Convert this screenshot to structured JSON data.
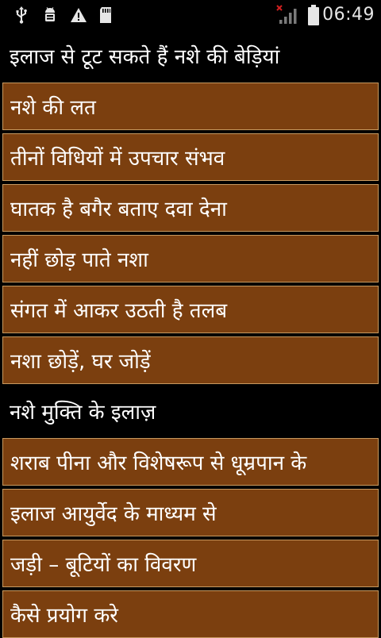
{
  "status_bar": {
    "icons": [
      "usb-icon",
      "android-debug-icon",
      "warning-icon",
      "sd-card-icon",
      "signal-no-service-icon",
      "battery-icon"
    ],
    "time": "06:49"
  },
  "list": {
    "rows": [
      {
        "type": "header",
        "label": "इलाज से टूट सकते हैं नशे की बेड़ियां"
      },
      {
        "type": "item",
        "label": "नशे की लत"
      },
      {
        "type": "item",
        "label": "तीनों विधियों में उपचार संभव"
      },
      {
        "type": "item",
        "label": "घातक है बगैर बताए दवा देना"
      },
      {
        "type": "item",
        "label": "नहीं छोड़ पाते नशा"
      },
      {
        "type": "item",
        "label": "संगत में आकर उठती है तलब"
      },
      {
        "type": "item",
        "label": "नशा छोड़ें, घर जोड़ें"
      },
      {
        "type": "header",
        "label": "नशे मुक्ति के इलाज़"
      },
      {
        "type": "item",
        "label": "शराब पीना और विशेषरूप से धूम्रपान के"
      },
      {
        "type": "item",
        "label": "इलाज आयुर्वेद के माध्यम से"
      },
      {
        "type": "item",
        "label": "जड़ी – बूटियों का विवरण"
      },
      {
        "type": "item",
        "label": "कैसे प्रयोग करे"
      }
    ]
  },
  "colors": {
    "item_background": "#7b3f0f",
    "item_border": "#c7995f",
    "header_background": "#000000",
    "text": "#ffffff"
  }
}
